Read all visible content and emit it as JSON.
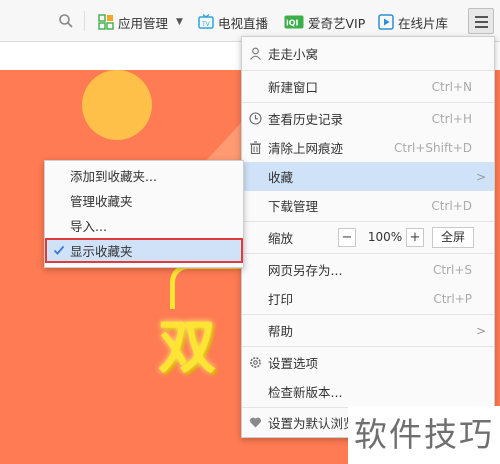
{
  "toolbar": {
    "items": [
      {
        "label": "应用管理",
        "icon": "apps-grid-icon",
        "color": "#3cae4a"
      },
      {
        "label": "电视直播",
        "icon": "tv-icon",
        "color": "#2aa6d8"
      },
      {
        "label": "爱奇艺VIP",
        "icon": "iqiyi-icon",
        "color": "#3cae4a"
      },
      {
        "label": "在线片库",
        "icon": "film-library-icon",
        "color": "#2a8fd8"
      }
    ],
    "search_icon": "search-icon",
    "menu_icon": "hamburger-menu-icon"
  },
  "content": {
    "banner_text": "双"
  },
  "menu": {
    "user": "走走小窝",
    "new_window": "新建窗口",
    "new_window_sc": "Ctrl+N",
    "history": "查看历史记录",
    "history_sc": "Ctrl+H",
    "clear": "清除上网痕迹",
    "clear_sc": "Ctrl+Shift+D",
    "favorites": "收藏",
    "downloads": "下载管理",
    "downloads_sc": "Ctrl+D",
    "zoom_label": "缩放",
    "zoom_minus": "−",
    "zoom_value": "100%",
    "zoom_plus": "+",
    "fullscreen": "全屏",
    "save_as": "网页另存为...",
    "save_as_sc": "Ctrl+S",
    "print": "打印",
    "print_sc": "Ctrl+P",
    "help": "帮助",
    "settings": "设置选项",
    "check_update": "检查新版本...",
    "set_default": "设置为默认浏览"
  },
  "submenu": {
    "add": "添加到收藏夹...",
    "manage": "管理收藏夹",
    "import": "导入...",
    "show": "显示收藏夹"
  },
  "watermark": "软件技巧",
  "colors": {
    "accent_blue": "#cfe2f8",
    "highlight_border": "#e03b3b",
    "banner_bg": "#ff7b53",
    "banner_text": "#ffe533"
  }
}
